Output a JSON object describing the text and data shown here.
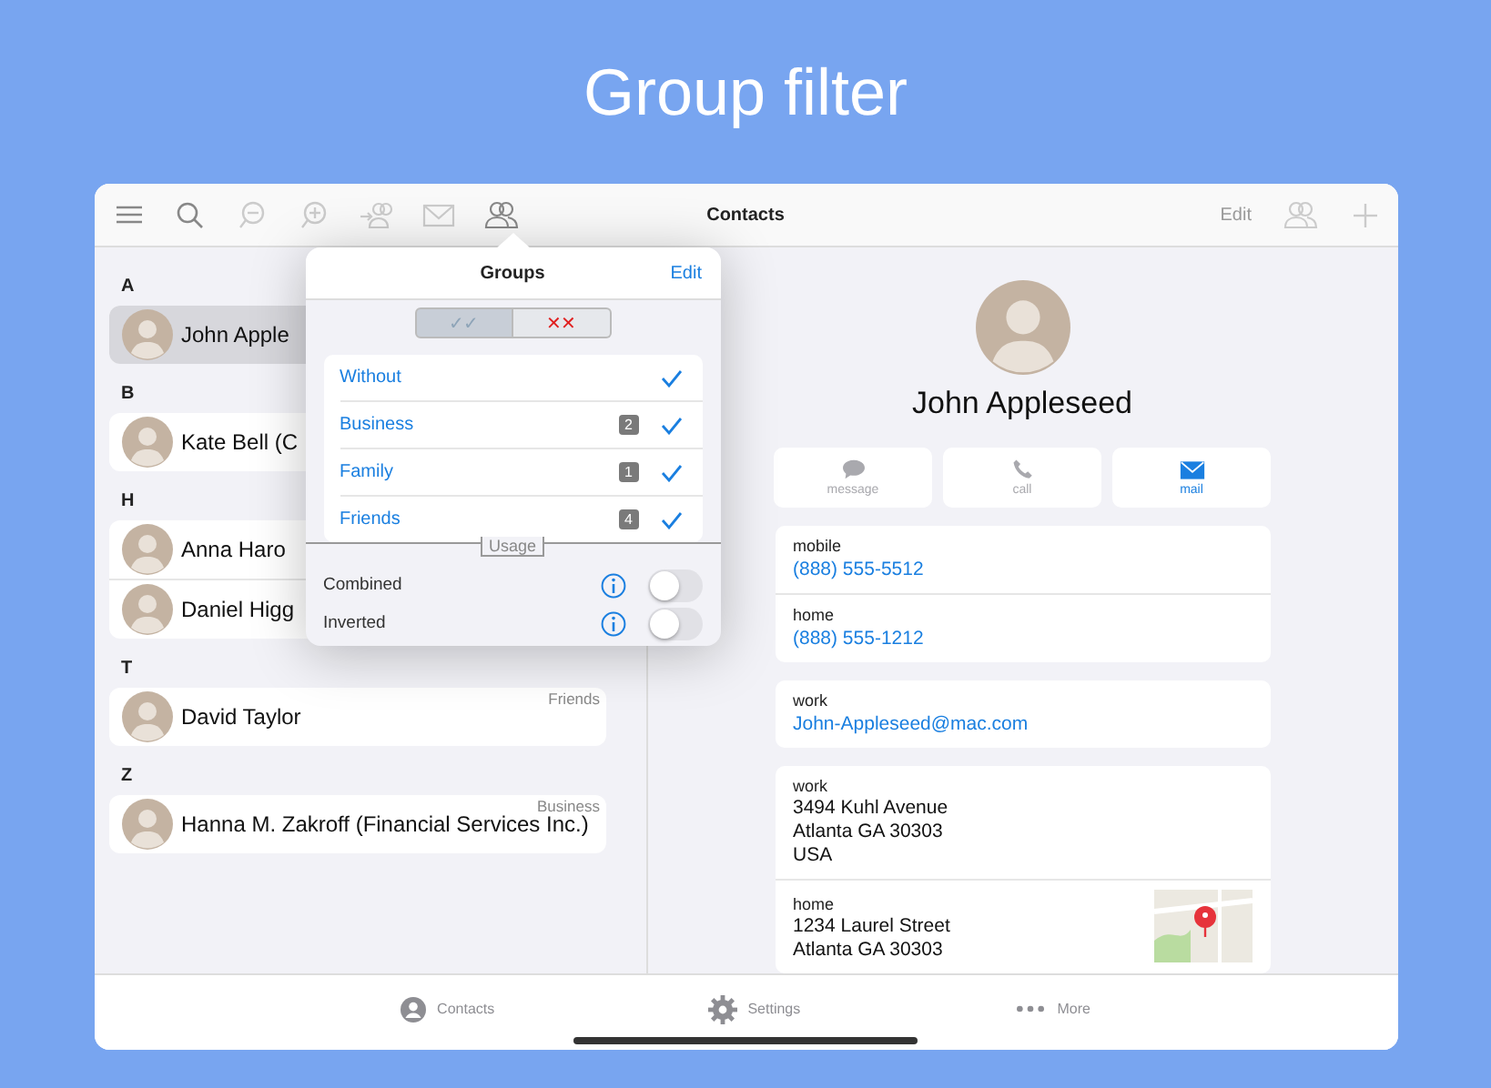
{
  "title": "Group filter",
  "toolbar": {
    "title": "Contacts",
    "edit": "Edit",
    "left_icons": [
      {
        "kind": "menu",
        "disabled": false
      },
      {
        "kind": "search",
        "disabled": false
      },
      {
        "kind": "zoom-out",
        "disabled": true
      },
      {
        "kind": "zoom-in",
        "disabled": true
      },
      {
        "kind": "add-to-group",
        "disabled": true
      },
      {
        "kind": "mail",
        "disabled": true
      },
      {
        "kind": "people",
        "disabled": false
      }
    ],
    "right_icons": [
      {
        "kind": "people",
        "disabled": true
      },
      {
        "kind": "plus",
        "disabled": true
      }
    ]
  },
  "contacts": [
    {
      "letter": "A",
      "rows": [
        {
          "name": "John Apple",
          "selected": true
        }
      ]
    },
    {
      "letter": "B",
      "rows": [
        {
          "name": "Kate Bell (C",
          "selected": false
        }
      ]
    },
    {
      "letter": "H",
      "rows": [
        {
          "name": "Anna Haro",
          "selected": false
        },
        {
          "name": "Daniel Higg",
          "selected": false
        }
      ]
    },
    {
      "letter": "T",
      "rows": [
        {
          "name": "David Taylor",
          "group": "Friends",
          "selected": false
        }
      ]
    },
    {
      "letter": "Z",
      "rows": [
        {
          "name": "Hanna M. Zakroff (Financial Services Inc.)",
          "group": "Business",
          "selected": false
        }
      ]
    }
  ],
  "popover": {
    "title": "Groups",
    "edit": "Edit",
    "segments": [
      {
        "label": "✓✓",
        "kind": "check",
        "selected": true
      },
      {
        "label": "✕✕",
        "kind": "cross",
        "selected": false
      }
    ],
    "groups": [
      {
        "name": "Without",
        "checked": true
      },
      {
        "name": "Business",
        "count": "2",
        "checked": true
      },
      {
        "name": "Family",
        "count": "1",
        "checked": true
      },
      {
        "name": "Friends",
        "count": "4",
        "checked": true
      }
    ],
    "usage_label": "Usage",
    "options": [
      {
        "label": "Combined",
        "on": false
      },
      {
        "label": "Inverted",
        "on": false
      }
    ]
  },
  "detail": {
    "name": "John Appleseed",
    "actions": [
      {
        "label": "message",
        "kind": "message",
        "disabled": true
      },
      {
        "label": "call",
        "kind": "call",
        "disabled": true
      },
      {
        "label": "mail",
        "kind": "mail",
        "disabled": false
      }
    ],
    "cards": [
      [
        {
          "label": "mobile",
          "kind": "link",
          "value": "(888) 555-5512"
        },
        {
          "label": "home",
          "kind": "link",
          "value": "(888) 555-1212"
        }
      ],
      [
        {
          "label": "work",
          "kind": "link",
          "value": "John-Appleseed@mac.com"
        }
      ],
      [
        {
          "label": "work",
          "kind": "address",
          "lines": [
            "3494 Kuhl Avenue",
            "Atlanta GA 30303",
            "USA"
          ]
        },
        {
          "label": "home",
          "kind": "address",
          "lines": [
            "1234 Laurel Street",
            "Atlanta GA 30303"
          ],
          "map": true
        }
      ]
    ]
  },
  "tabbar": [
    {
      "label": "Contacts",
      "kind": "person"
    },
    {
      "label": "Settings",
      "kind": "gear"
    },
    {
      "label": "More",
      "kind": "more"
    }
  ]
}
